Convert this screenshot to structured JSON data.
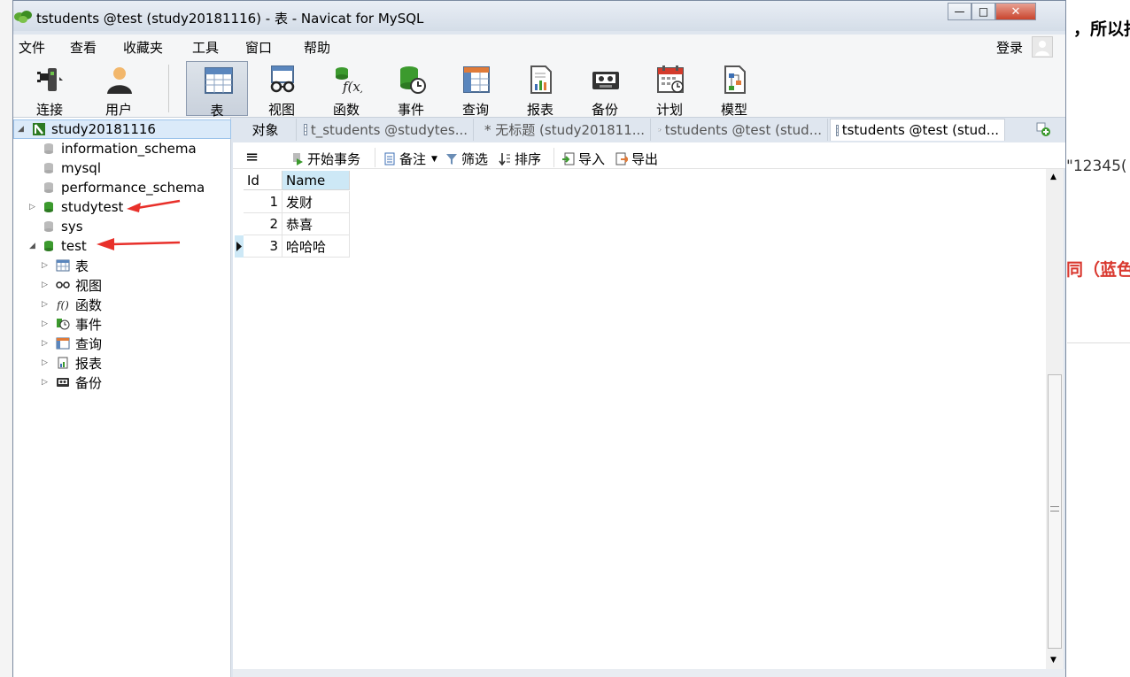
{
  "window": {
    "title": "tstudents @test (study20181116) - 表 - Navicat for MySQL",
    "minimize": "—",
    "maximize": "□",
    "close": "✕"
  },
  "menu": {
    "items": [
      "文件",
      "查看",
      "收藏夹",
      "工具",
      "窗口",
      "帮助"
    ],
    "login": "登录"
  },
  "toolbar": {
    "items": [
      {
        "label": "连接",
        "icon": "plug-icon"
      },
      {
        "label": "用户",
        "icon": "user-icon"
      },
      {
        "label": "表",
        "icon": "table-icon"
      },
      {
        "label": "视图",
        "icon": "view-glasses-icon"
      },
      {
        "label": "函数",
        "icon": "function-icon"
      },
      {
        "label": "事件",
        "icon": "event-clock-icon"
      },
      {
        "label": "查询",
        "icon": "query-icon"
      },
      {
        "label": "报表",
        "icon": "report-icon"
      },
      {
        "label": "备份",
        "icon": "backup-tape-icon"
      },
      {
        "label": "计划",
        "icon": "calendar-icon"
      },
      {
        "label": "模型",
        "icon": "model-icon"
      }
    ],
    "active": "表"
  },
  "sidebar": {
    "connection": "study20181116",
    "databases": [
      "information_schema",
      "mysql",
      "performance_schema",
      "studytest",
      "sys",
      "test"
    ],
    "test_children": [
      "表",
      "视图",
      "函数",
      "事件",
      "查询",
      "报表",
      "备份"
    ]
  },
  "tabs": [
    {
      "label": "对象"
    },
    {
      "label": "t_students @studytes..."
    },
    {
      "label": "* 无标题 (study201811..."
    },
    {
      "label": "tstudents @test (stud..."
    },
    {
      "label": "tstudents @test (stud..."
    }
  ],
  "object_toolbar": {
    "begin_transaction": "开始事务",
    "note": "备注",
    "filter": "筛选",
    "sort": "排序",
    "import": "导入",
    "export": "导出"
  },
  "grid": {
    "columns": [
      "Id",
      "Name"
    ],
    "rows": [
      {
        "id": "1",
        "name": "发财"
      },
      {
        "id": "2",
        "name": "恭喜"
      },
      {
        "id": "3",
        "name": "哈哈哈"
      }
    ]
  },
  "background": {
    "top_right": "，所以指",
    "mid_right": "\"12345(",
    "red_right": "同（蓝色"
  },
  "colors": {
    "db_green": "#3c9a2e",
    "arrow_red": "#e8302a",
    "selection_blue": "#dbeaf9",
    "header_blue": "#cde8f6"
  }
}
